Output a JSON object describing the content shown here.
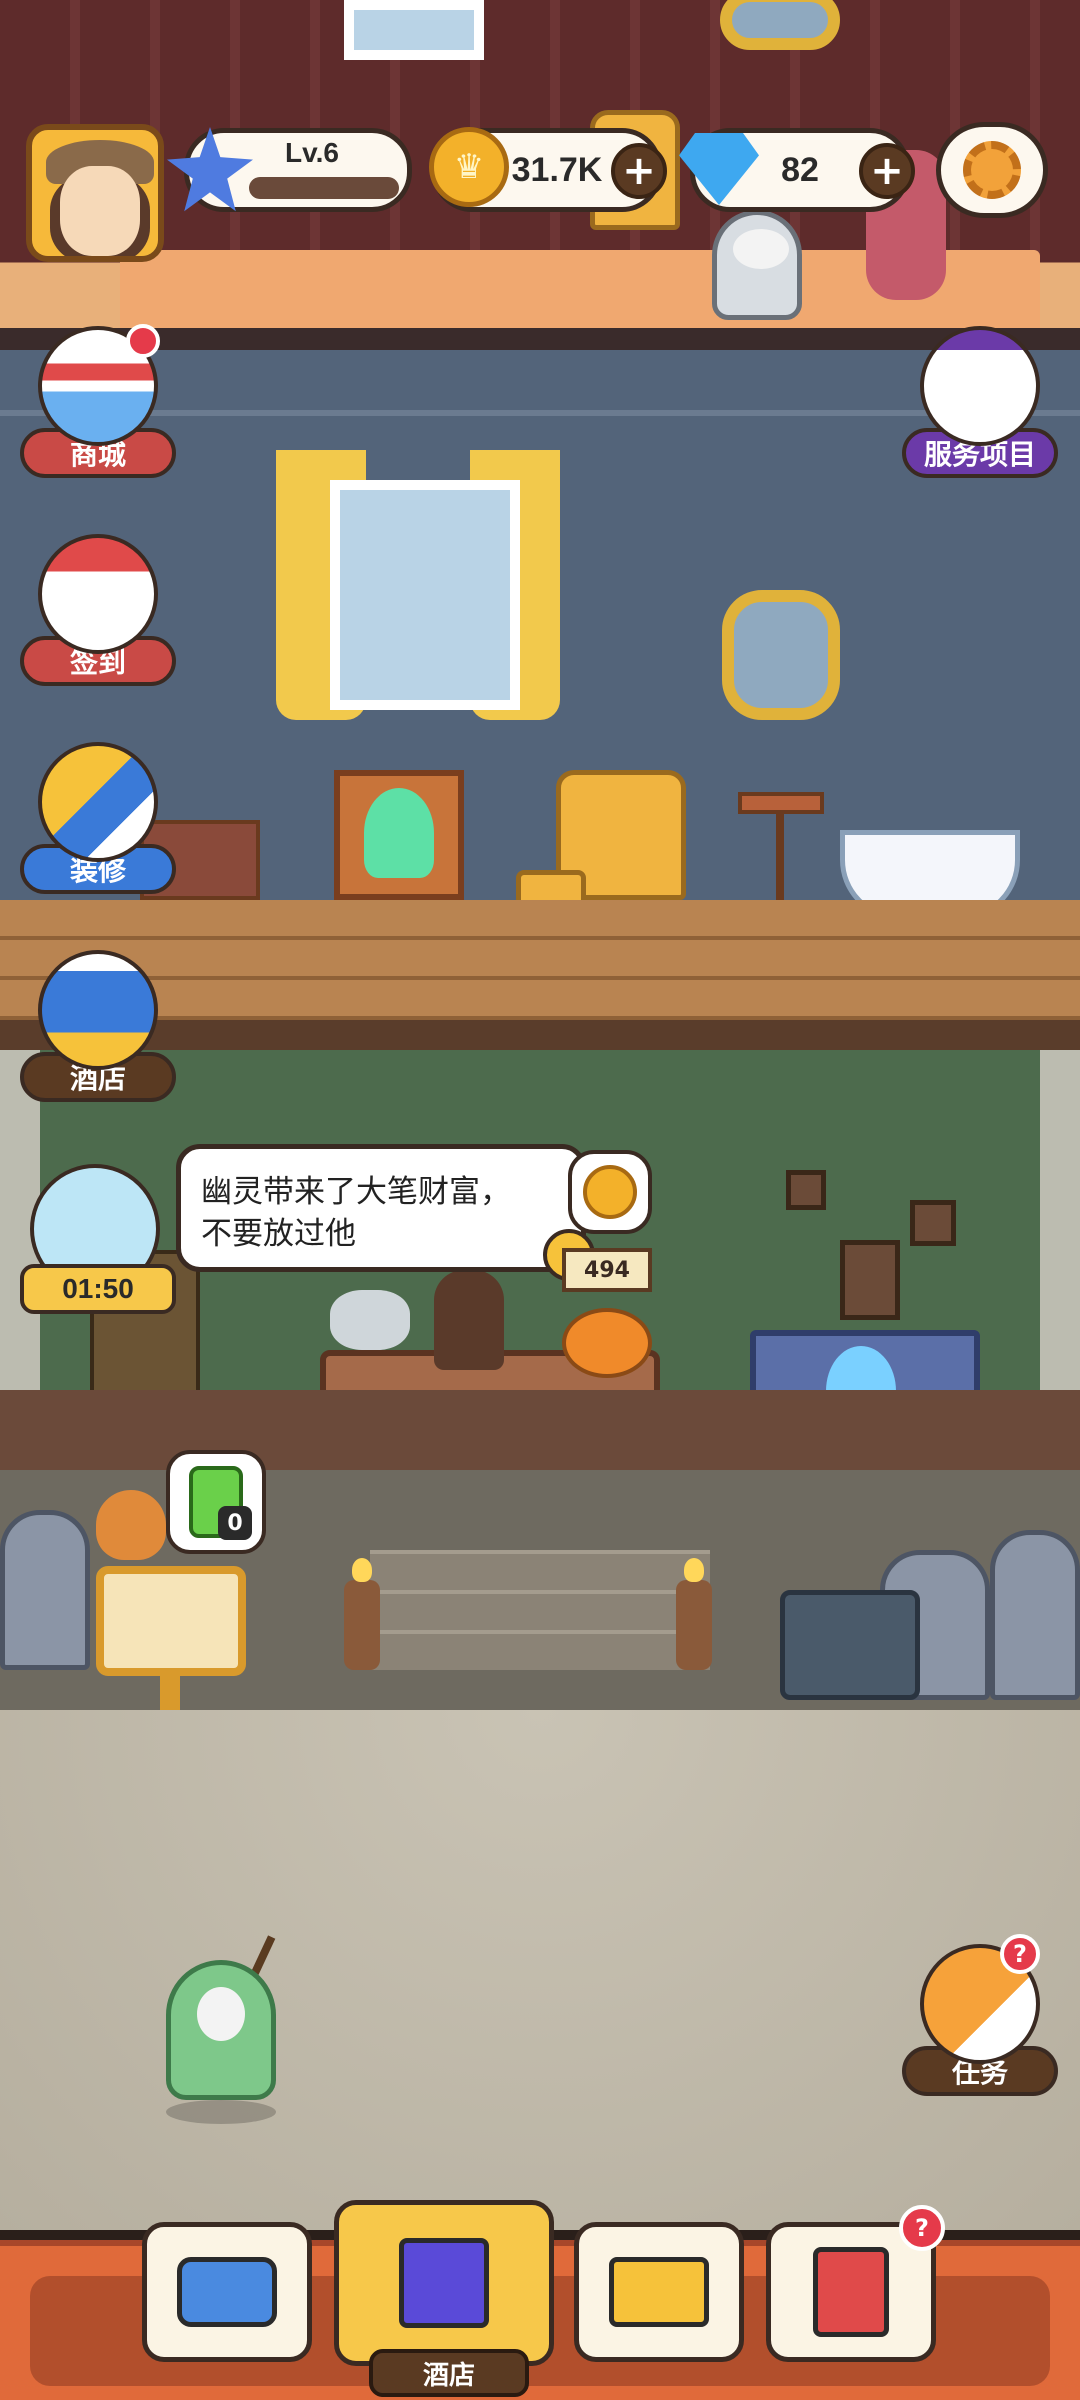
{
  "hud": {
    "level": "Lv.6",
    "coins": "31.7K",
    "gems": "82",
    "plus": "+"
  },
  "side_left": {
    "shop": "商城",
    "checkin": "签到",
    "decorate": "装修",
    "hotel": "酒店"
  },
  "side_right": {
    "services": "服务项目",
    "tasks": "任务",
    "tasks_badge": "?"
  },
  "ghost": {
    "timer": "01:50",
    "speech_line1": "幽灵带来了大笔财富，",
    "speech_line2": "不要放过他"
  },
  "desk": {
    "price": "494"
  },
  "energy": {
    "count": "0"
  },
  "bottom_nav": {
    "hotel": "酒店",
    "badge": "?"
  }
}
